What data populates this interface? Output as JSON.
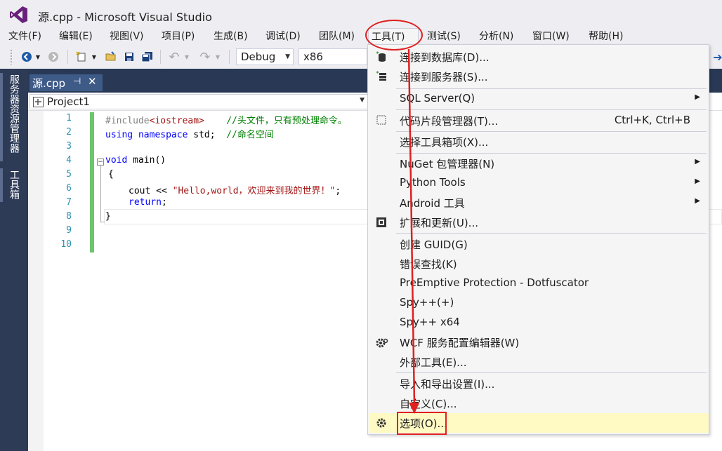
{
  "window": {
    "title": "源.cpp - Microsoft Visual Studio"
  },
  "menubar": {
    "items": [
      "文件(F)",
      "编辑(E)",
      "视图(V)",
      "项目(P)",
      "生成(B)",
      "调试(D)",
      "团队(M)",
      "工具(T)",
      "测试(S)",
      "分析(N)",
      "窗口(W)",
      "帮助(H)"
    ]
  },
  "toolbar": {
    "configuration": "Debug",
    "platform": "x86"
  },
  "leftstrip": {
    "tab1": "服务器资源管理器",
    "tab2": "工具箱"
  },
  "document": {
    "tab_label": "源.cpp",
    "project": "Project1"
  },
  "editor": {
    "line_numbers": [
      "1",
      "2",
      "3",
      "4",
      "5",
      "6",
      "7",
      "8",
      "9",
      "10"
    ],
    "lines": [
      {
        "pp": "#include",
        "inc": "<iostream>",
        "comment": "//头文件，只有预处理命令。"
      },
      {
        "kw1": "using",
        "kw2": "namespace",
        "text": " std;",
        "comment": "//命名空间"
      },
      {},
      {
        "kw": "void",
        "text": " main()"
      },
      {
        "text": "{"
      },
      {
        "text": "cout << ",
        "str": "\"Hello,world，欢迎来到我的世界！\"",
        "tail": ";"
      },
      {
        "kw": "return",
        "text": ";"
      },
      {
        "text": "}"
      }
    ]
  },
  "tools_menu": {
    "items": [
      {
        "label": "连接到数据库(D)...",
        "icon": "database-connect-icon"
      },
      {
        "label": "连接到服务器(S)...",
        "icon": "server-connect-icon"
      },
      {
        "label": "SQL Server(Q)",
        "submenu": true
      },
      {
        "label": "代码片段管理器(T)...",
        "shortcut": "Ctrl+K, Ctrl+B",
        "icon": "snippet-icon"
      },
      {
        "label": "选择工具箱项(X)..."
      },
      {
        "label": "NuGet 包管理器(N)",
        "submenu": true
      },
      {
        "label": "Python Tools",
        "submenu": true
      },
      {
        "label": "Android 工具",
        "submenu": true
      },
      {
        "label": "扩展和更新(U)...",
        "icon": "extensions-icon"
      },
      {
        "label": "创建 GUID(G)"
      },
      {
        "label": "错误查找(K)"
      },
      {
        "label": "PreEmptive Protection - Dotfuscator"
      },
      {
        "label": "Spy++(+)"
      },
      {
        "label": "Spy++ x64"
      },
      {
        "label": "WCF 服务配置编辑器(W)",
        "icon": "wcf-gear-icon"
      },
      {
        "label": "外部工具(E)..."
      },
      {
        "label": "导入和导出设置(I)..."
      },
      {
        "label": "自定义(C)..."
      },
      {
        "label": "选项(O)...",
        "icon": "gear-icon",
        "highlighted": true
      }
    ]
  },
  "colors": {
    "accent": "#2d3b57",
    "annotation": "#e02020",
    "highlight": "#fff9c4"
  }
}
